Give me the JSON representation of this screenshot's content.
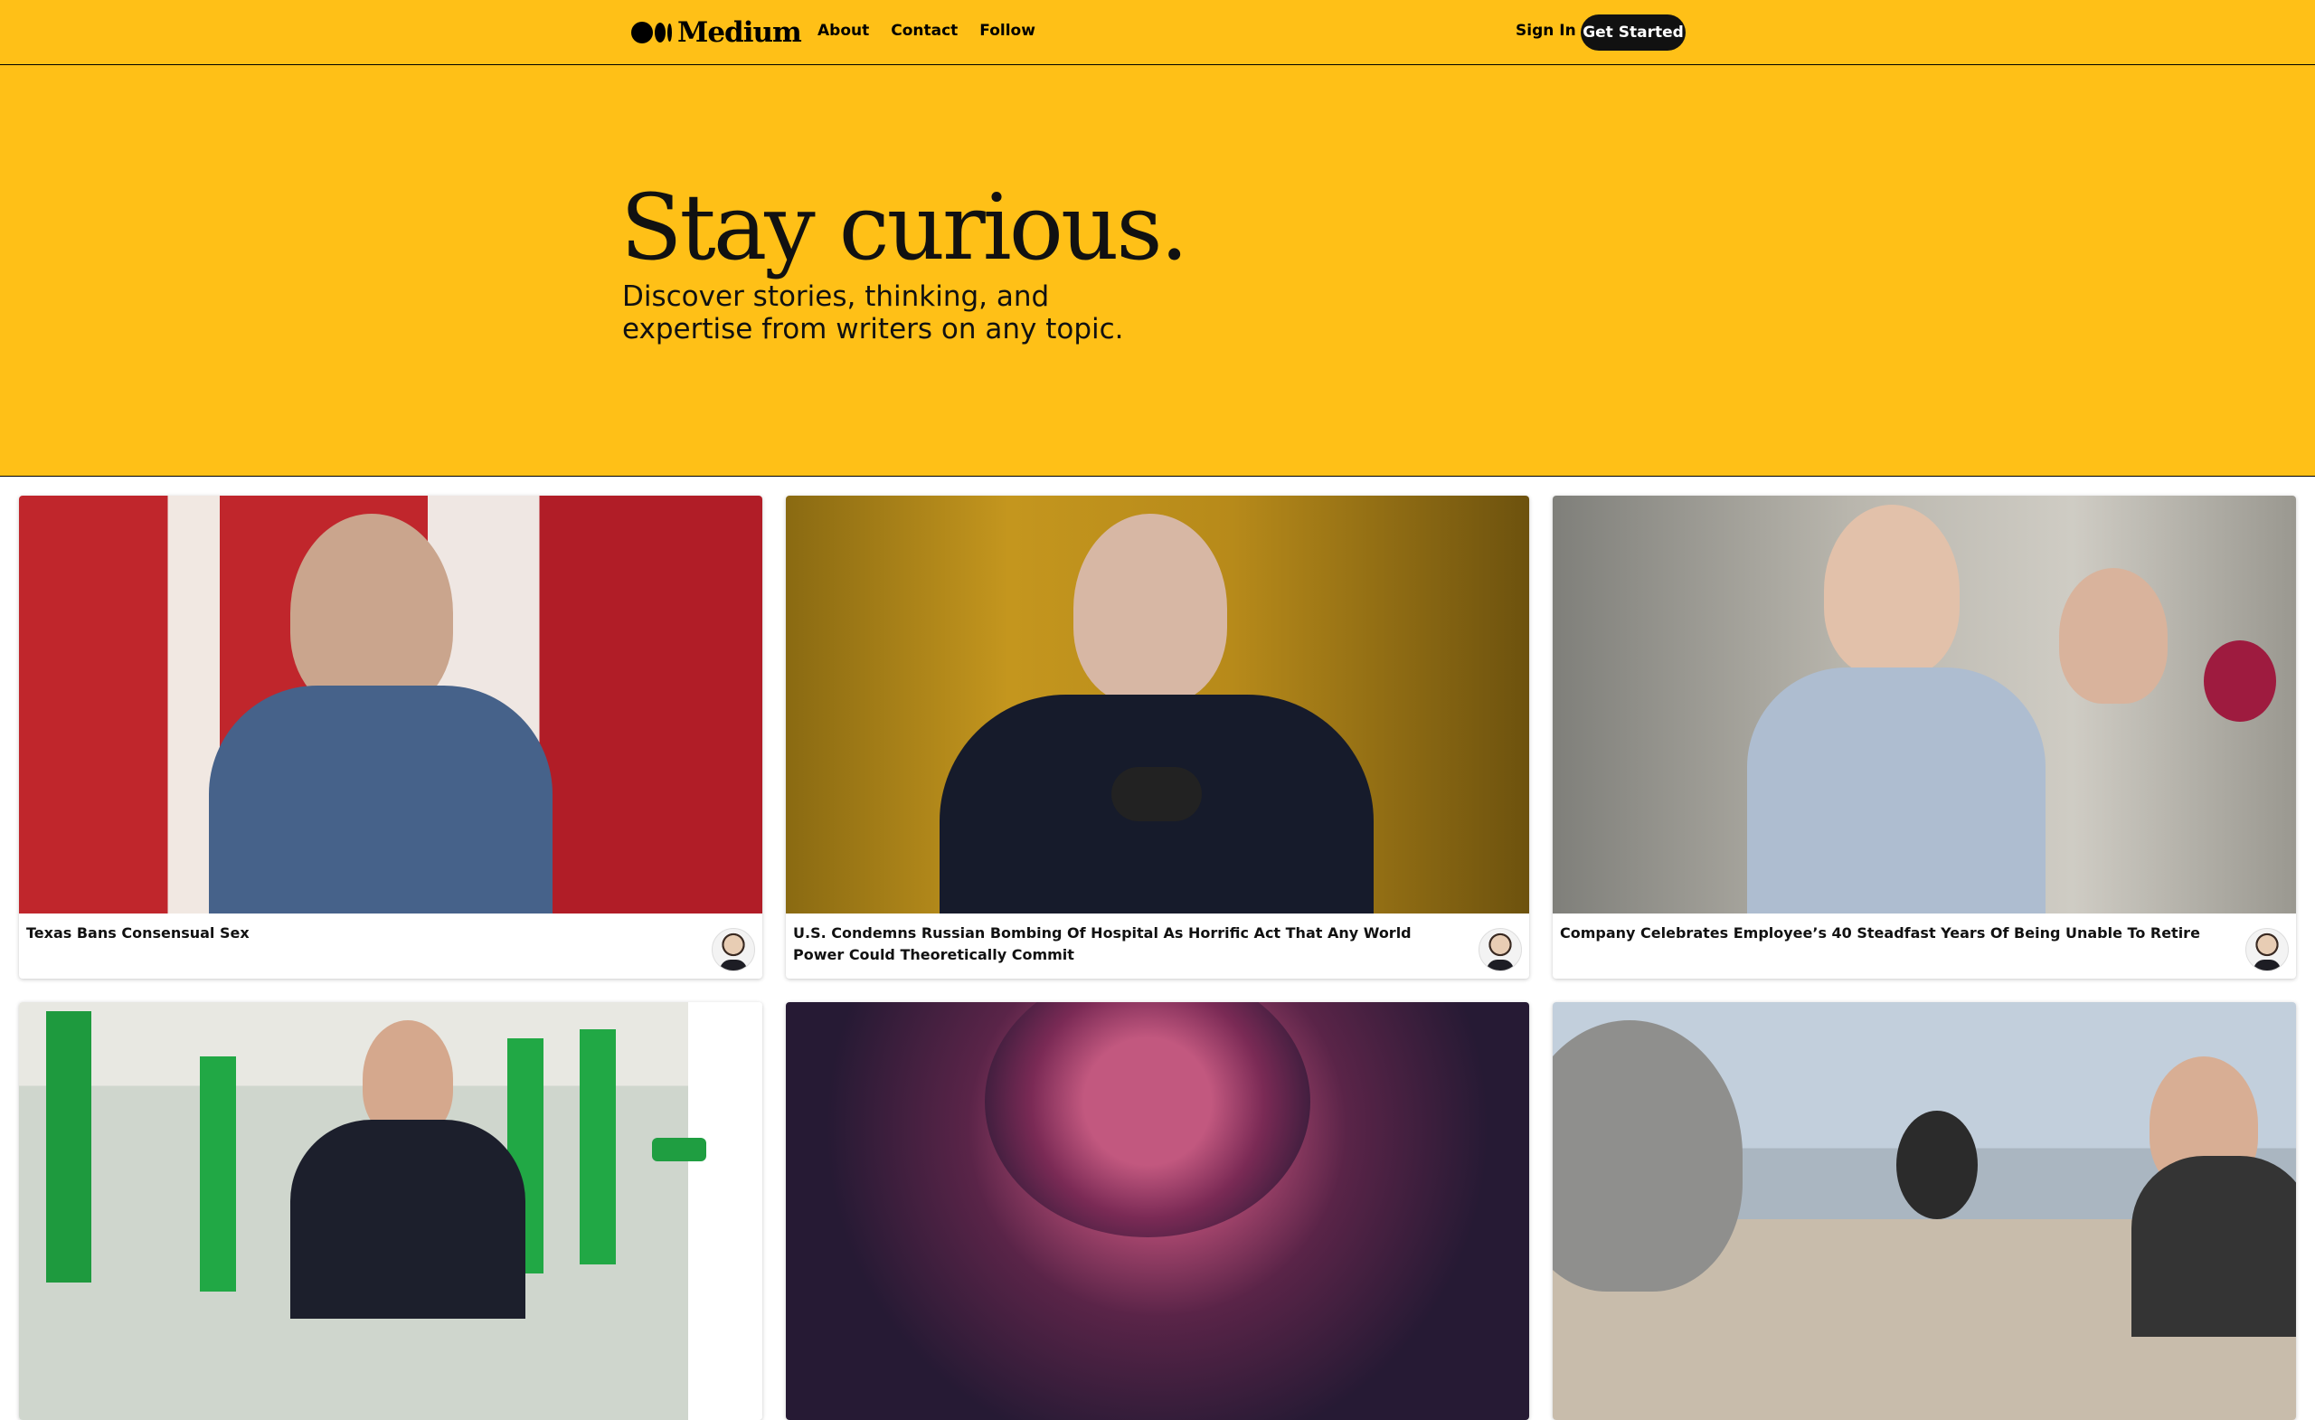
{
  "header": {
    "brand": "Medium",
    "nav": [
      "About",
      "Contact",
      "Follow"
    ],
    "sign_in": "Sign In",
    "get_started": "Get Started"
  },
  "hero": {
    "title": "Stay curious.",
    "subtitle": "Discover stories, thinking, and expertise from writers on any topic."
  },
  "stories": [
    {
      "title": "Texas Bans Consensual Sex"
    },
    {
      "title": "U.S. Condemns Russian Bombing Of Hospital As Horrific Act That Any World Power Could Theoretically Commit"
    },
    {
      "title": "Company Celebrates Employee’s 40 Steadfast Years Of Being Unable To Retire"
    },
    {
      "title": ""
    },
    {
      "title": ""
    },
    {
      "title": ""
    }
  ],
  "colors": {
    "brand_yellow": "#FFC017",
    "button_dark": "#111111"
  }
}
